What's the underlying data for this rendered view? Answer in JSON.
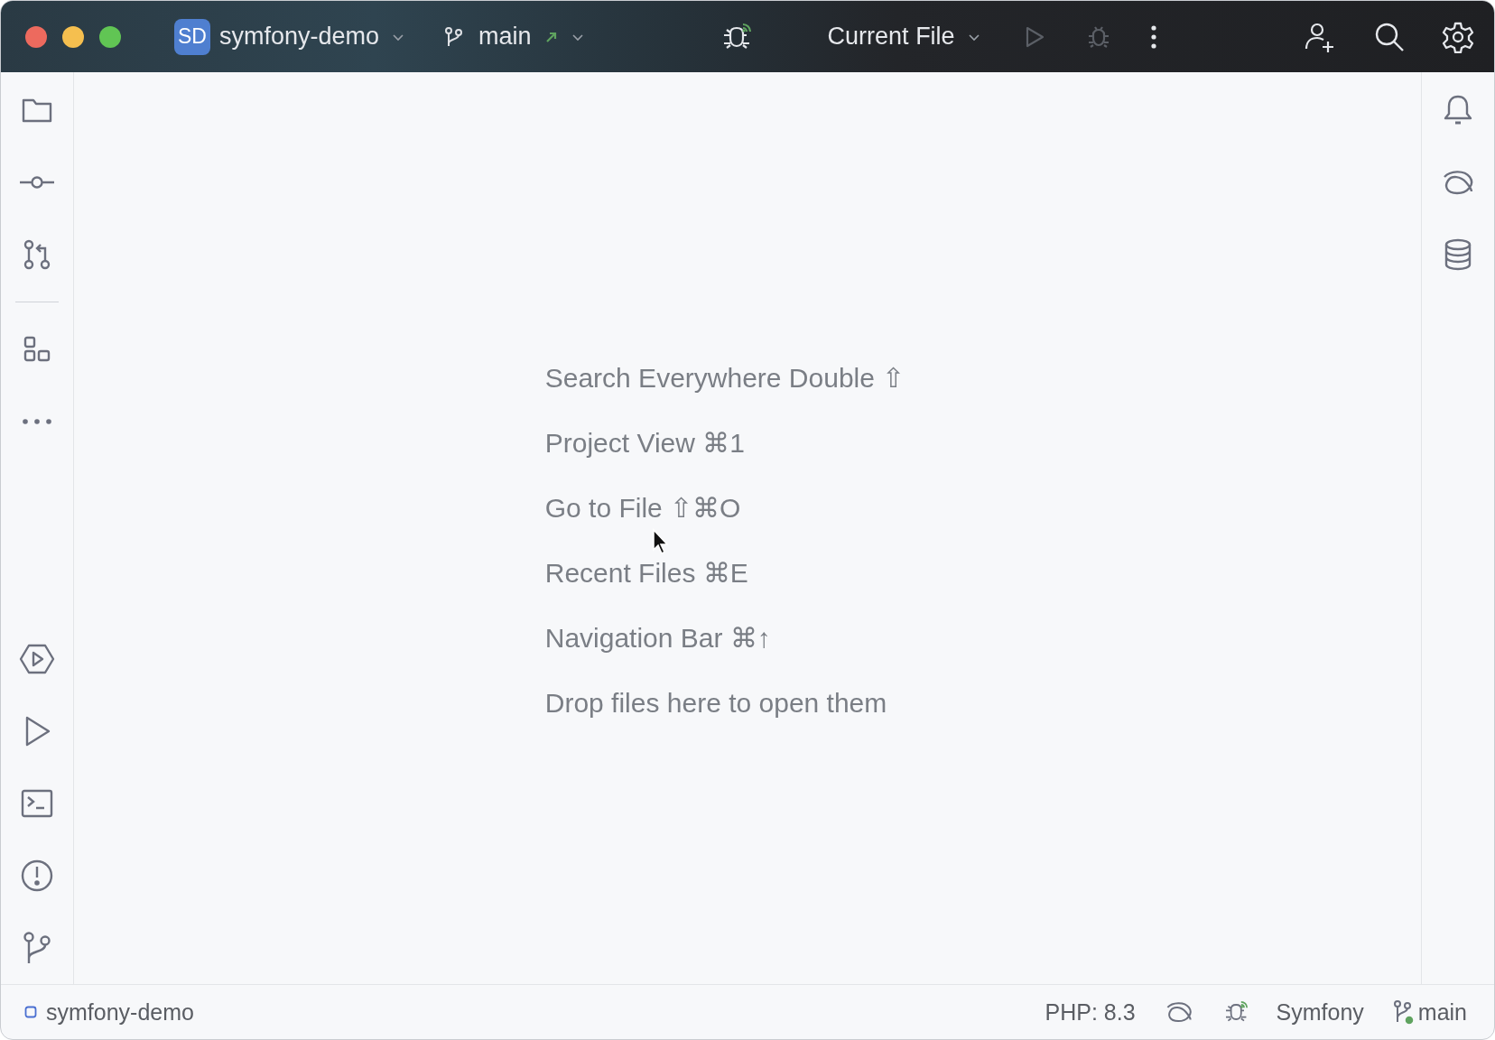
{
  "title_bar": {
    "project": {
      "badge": "SD",
      "name": "symfony-demo"
    },
    "branch": {
      "name": "main"
    },
    "run_config": {
      "label": "Current File"
    },
    "run_button": {
      "disabled": true
    },
    "debug_button": {
      "disabled": true
    }
  },
  "editor_hints": [
    "Search Everywhere Double ⇧",
    "Project View ⌘1",
    "Go to File ⇧⌘O",
    "Recent Files ⌘E",
    "Navigation Bar ⌘↑",
    "Drop files here to open them"
  ],
  "status_bar": {
    "project": "symfony-demo",
    "php_version": "PHP: 8.3",
    "framework": "Symfony",
    "branch": "main"
  }
}
